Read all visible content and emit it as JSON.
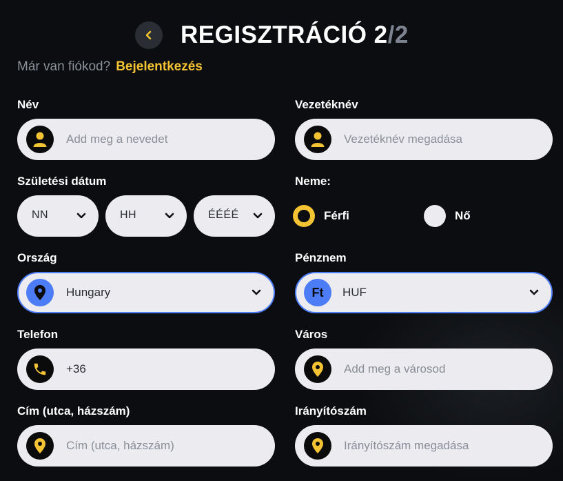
{
  "header": {
    "title_main": "REGISZTRÁCIÓ 2",
    "title_sep": "/",
    "title_total": "2"
  },
  "login": {
    "question": "Már van fiókod?",
    "link": "Bejelentkezés"
  },
  "form": {
    "name": {
      "label": "Név",
      "placeholder": "Add meg a nevedet",
      "icon": "user-icon"
    },
    "surname": {
      "label": "Vezetéknév",
      "placeholder": "Vezetéknév megadása",
      "icon": "user-icon"
    },
    "birthdate": {
      "label": "Születési dátum",
      "day": "NN",
      "month": "HH",
      "year": "ÉÉÉÉ"
    },
    "gender": {
      "label": "Neme:",
      "options": [
        "Férfi",
        "Nő"
      ],
      "selected": "Férfi"
    },
    "country": {
      "label": "Ország",
      "value": "Hungary",
      "icon": "location-pin-icon"
    },
    "currency": {
      "label": "Pénznem",
      "value": "HUF",
      "symbol": "Ft"
    },
    "phone": {
      "label": "Telefon",
      "value": "+36",
      "icon": "phone-icon"
    },
    "city": {
      "label": "Város",
      "placeholder": "Add meg a városod",
      "icon": "location-pin-icon"
    },
    "address": {
      "label": "Cím (utca, házszám)",
      "placeholder": "Cím (utca, házszám)",
      "icon": "location-pin-icon"
    },
    "zip": {
      "label": "Irányítószám",
      "placeholder": "Irányítószám megadása",
      "icon": "location-pin-icon"
    }
  },
  "colors": {
    "background": "#0b0d10",
    "accent_yellow": "#f3c333",
    "accent_blue": "#4d7cf7",
    "field_bg": "#ebebf0",
    "muted_text": "#8d919a"
  }
}
